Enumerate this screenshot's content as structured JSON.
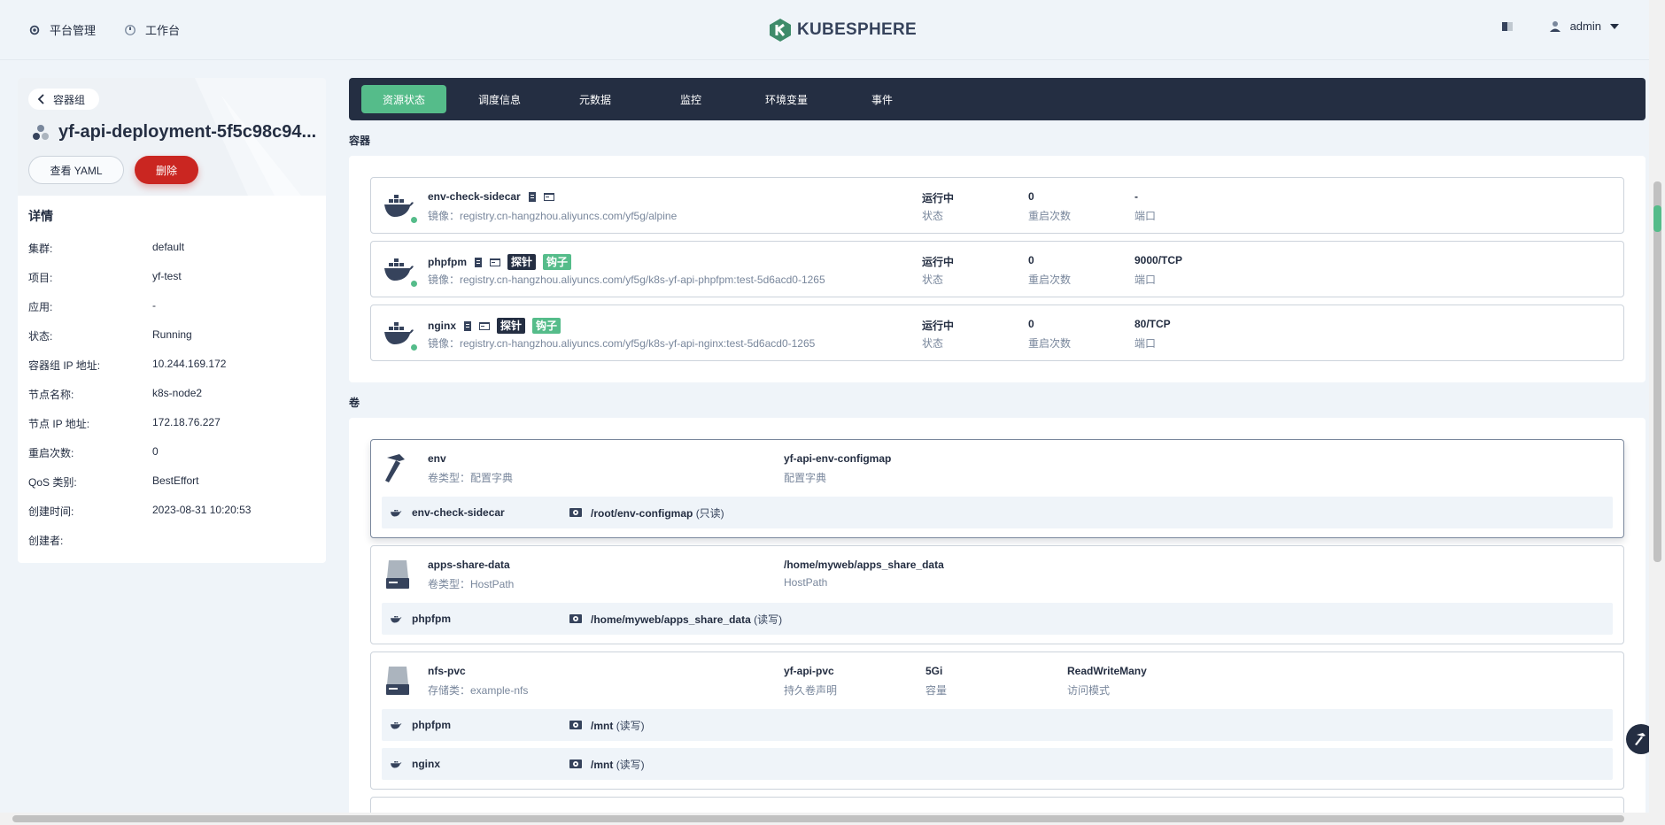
{
  "topbar": {
    "platform": "平台管理",
    "workbench": "工作台",
    "brand": "KUBESPHERE",
    "user": "admin"
  },
  "left": {
    "back": "容器组",
    "pod_name": "yf-api-deployment-5f5c98c94...",
    "yaml_btn": "查看 YAML",
    "delete_btn": "删除",
    "details_title": "详情",
    "details": [
      {
        "k": "集群:",
        "v": "default"
      },
      {
        "k": "项目:",
        "v": "yf-test"
      },
      {
        "k": "应用:",
        "v": "-"
      },
      {
        "k": "状态:",
        "v": "Running"
      },
      {
        "k": "容器组 IP 地址:",
        "v": "10.244.169.172"
      },
      {
        "k": "节点名称:",
        "v": "k8s-node2"
      },
      {
        "k": "节点 IP 地址:",
        "v": "172.18.76.227"
      },
      {
        "k": "重启次数:",
        "v": "0"
      },
      {
        "k": "QoS 类别:",
        "v": "BestEffort"
      },
      {
        "k": "创建时间:",
        "v": "2023-08-31 10:20:53"
      },
      {
        "k": "创建者:",
        "v": ""
      }
    ]
  },
  "tabs": [
    "资源状态",
    "调度信息",
    "元数据",
    "监控",
    "环境变量",
    "事件"
  ],
  "containers_label": "容器",
  "volumes_label": "卷",
  "labels": {
    "status": "状态",
    "restarts": "重启次数",
    "ports": "端口",
    "image_prefix": "镜像：",
    "probe": "探针",
    "hook": "钩子"
  },
  "containers": [
    {
      "name": "env-check-sidecar",
      "image": "镜像：registry.cn-hangzhou.aliyuncs.com/yf5g/alpine",
      "status": "运行中",
      "restarts": "0",
      "port": "-"
    },
    {
      "name": "phpfpm",
      "image": "镜像：registry.cn-hangzhou.aliyuncs.com/yf5g/k8s-yf-api-phpfpm:test-5d6acd0-1265",
      "status": "运行中",
      "restarts": "0",
      "port": "9000/TCP"
    },
    {
      "name": "nginx",
      "image": "镜像：registry.cn-hangzhou.aliyuncs.com/yf5g/k8s-yf-api-nginx:test-5d6acd0-1265",
      "status": "运行中",
      "restarts": "0",
      "port": "80/TCP"
    }
  ],
  "volumes": [
    {
      "name": "env",
      "sub": "卷类型：配置字典",
      "ref": "yf-api-env-configmap",
      "ref_label": "配置字典",
      "mounts": [
        {
          "container": "env-check-sidecar",
          "path": "/root/env-configmap",
          "mode": "(只读)"
        }
      ]
    },
    {
      "name": "apps-share-data",
      "sub": "卷类型：HostPath",
      "ref": "/home/myweb/apps_share_data",
      "ref_label": "HostPath",
      "mounts": [
        {
          "container": "phpfpm",
          "path": "/home/myweb/apps_share_data",
          "mode": "(读写)"
        }
      ]
    },
    {
      "name": "nfs-pvc",
      "sub": "存储类：example-nfs",
      "ref": "yf-api-pvc",
      "ref_label": "持久卷声明",
      "capacity": "5Gi",
      "capacity_label": "容量",
      "access": "ReadWriteMany",
      "access_label": "访问模式",
      "mounts": [
        {
          "container": "phpfpm",
          "path": "/mnt",
          "mode": "(读写)"
        },
        {
          "container": "nginx",
          "path": "/mnt",
          "mode": "(读写)"
        }
      ]
    }
  ],
  "colors": {
    "accent": "#55bc8a",
    "danger": "#ca2621",
    "dark": "#242e42"
  }
}
